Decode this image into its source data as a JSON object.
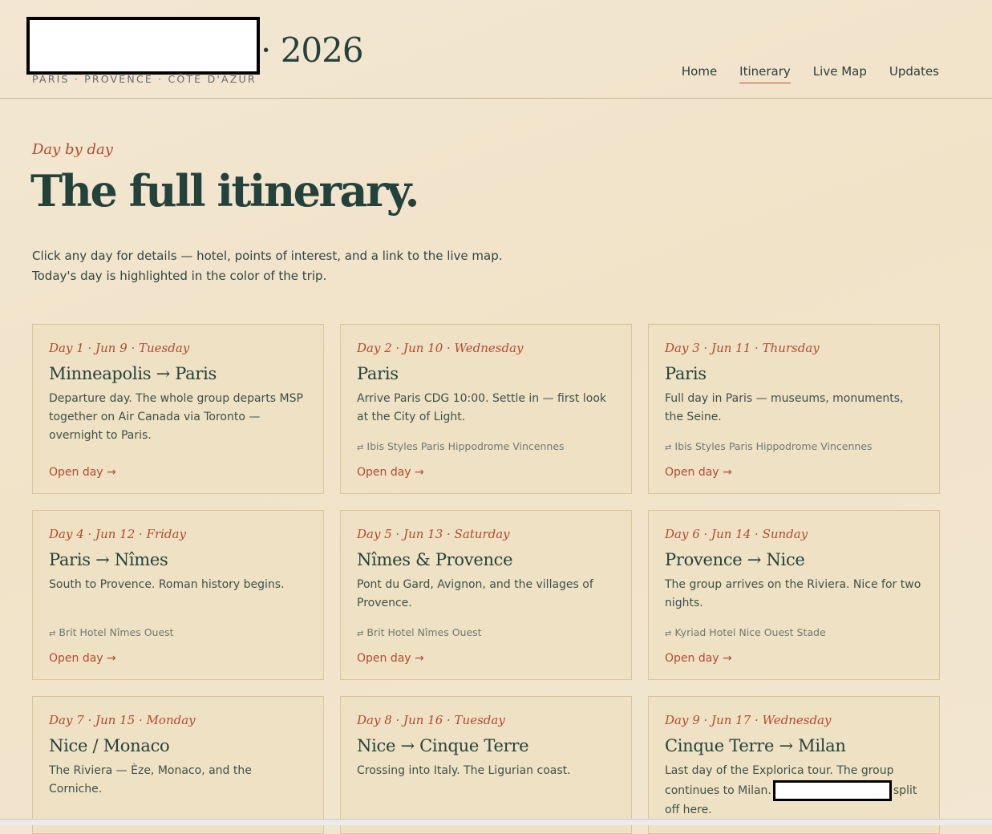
{
  "brand": {
    "year": "· 2026",
    "subtitle": "PARIS · PROVENCE · CÔTE D'AZUR"
  },
  "nav": [
    {
      "label": "Home",
      "active": false
    },
    {
      "label": "Itinerary",
      "active": true
    },
    {
      "label": "Live Map",
      "active": false
    },
    {
      "label": "Updates",
      "active": false
    }
  ],
  "page": {
    "eyebrow": "Day by day",
    "title": "The full itinerary.",
    "intro_line1": "Click any day for details — hotel, points of interest, and a link to the live map.",
    "intro_line2": "Today's day is highlighted in the color of the trip."
  },
  "open_day_label": "Open day →",
  "hotel_icon": "⇄",
  "days": [
    {
      "date": "Day 1 · Jun 9 · Tuesday",
      "title": "Minneapolis → Paris",
      "desc": "Departure day. The whole group departs MSP together on Air Canada via Toronto — overnight to Paris.",
      "hotel": ""
    },
    {
      "date": "Day 2 · Jun 10 · Wednesday",
      "title": "Paris",
      "desc": "Arrive Paris CDG 10:00. Settle in — first look at the City of Light.",
      "hotel": "Ibis Styles Paris Hippodrome Vincennes"
    },
    {
      "date": "Day 3 · Jun 11 · Thursday",
      "title": "Paris",
      "desc": "Full day in Paris — museums, monuments, the Seine.",
      "hotel": "Ibis Styles Paris Hippodrome Vincennes"
    },
    {
      "date": "Day 4 · Jun 12 · Friday",
      "title": "Paris → Nîmes",
      "desc": "South to Provence. Roman history begins.",
      "hotel": "Brit Hotel Nîmes Ouest"
    },
    {
      "date": "Day 5 · Jun 13 · Saturday",
      "title": "Nîmes & Provence",
      "desc": "Pont du Gard, Avignon, and the villages of Provence.",
      "hotel": "Brit Hotel Nîmes Ouest"
    },
    {
      "date": "Day 6 · Jun 14 · Sunday",
      "title": "Provence → Nice",
      "desc": "The group arrives on the Riviera. Nice for two nights.",
      "hotel": "Kyriad Hotel Nice Ouest Stade"
    },
    {
      "date": "Day 7 · Jun 15 · Monday",
      "title": "Nice / Monaco",
      "desc": "The Riviera — Èze, Monaco, and the Corniche.",
      "hotel": ""
    },
    {
      "date": "Day 8 · Jun 16 · Tuesday",
      "title": "Nice → Cinque Terre",
      "desc": "Crossing into Italy. The Ligurian coast.",
      "hotel": ""
    },
    {
      "date": "Day 9 · Jun 17 · Wednesday",
      "title": "Cinque Terre → Milan",
      "desc_before": "Last day of the Explorica tour. The group continues to Milan.",
      "desc_after": "split off here.",
      "hotel": ""
    }
  ]
}
